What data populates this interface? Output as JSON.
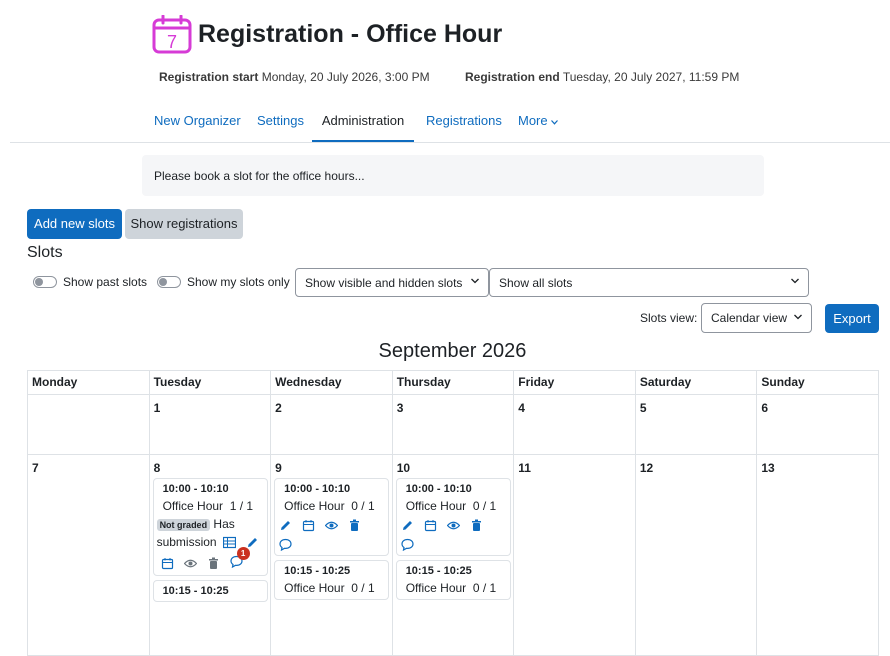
{
  "header": {
    "title": "Registration - Office Hour",
    "icon_day": "7",
    "start_label": "Registration start",
    "start_value": "Monday, 20 July 2026, 3:00 PM",
    "end_label": "Registration end",
    "end_value": "Tuesday, 20 July 2027, 11:59 PM"
  },
  "tabs": [
    {
      "label": "New Organizer"
    },
    {
      "label": "Settings"
    },
    {
      "label": "Administration",
      "active": true
    },
    {
      "label": "Registrations"
    },
    {
      "label": "More"
    }
  ],
  "intro": "Please book a slot for the office hours...",
  "actions": {
    "add_slots": "Add new slots",
    "show_registrations": "Show registrations"
  },
  "slots": {
    "heading": "Slots",
    "show_past": "Show past slots",
    "show_mine": "Show my slots only",
    "visibility_select": "Show visible and hidden slots",
    "filter_select": "Show all slots",
    "view_label": "Slots view:",
    "view_select": "Calendar view",
    "export": "Export"
  },
  "calendar": {
    "month": "September 2026",
    "days": [
      "Monday",
      "Tuesday",
      "Wednesday",
      "Thursday",
      "Friday",
      "Saturday",
      "Sunday"
    ],
    "week1": [
      "",
      "1",
      "2",
      "3",
      "4",
      "5",
      "6"
    ],
    "week2": [
      "7",
      "8",
      "9",
      "10",
      "11",
      "12",
      "13"
    ],
    "tue": {
      "slot1": {
        "time": "10:00 - 10:10",
        "name": "Office Hour",
        "count": "1 / 1",
        "grade": "Not graded",
        "sub1": "Has",
        "sub2": "submission",
        "notif": "1"
      },
      "slot2": {
        "time": "10:15 - 10:25"
      }
    },
    "wed": {
      "slot1": {
        "time": "10:00 - 10:10",
        "name": "Office Hour",
        "count": "0 / 1"
      },
      "slot2": {
        "time": "10:15 - 10:25",
        "name": "Office Hour",
        "count": "0 / 1"
      }
    },
    "thu": {
      "slot1": {
        "time": "10:00 - 10:10",
        "name": "Office Hour",
        "count": "0 / 1"
      },
      "slot2": {
        "time": "10:15 - 10:25",
        "name": "Office Hour",
        "count": "0 / 1"
      }
    }
  },
  "colors": {
    "accent": "#0f6cbf",
    "icon_purple": "#d63bd6",
    "badge_red": "#ca3120"
  },
  "icons": [
    "calendar-icon",
    "edit-icon",
    "eye-icon",
    "trash-icon",
    "comment-icon",
    "table-icon",
    "chevron-down-icon"
  ]
}
